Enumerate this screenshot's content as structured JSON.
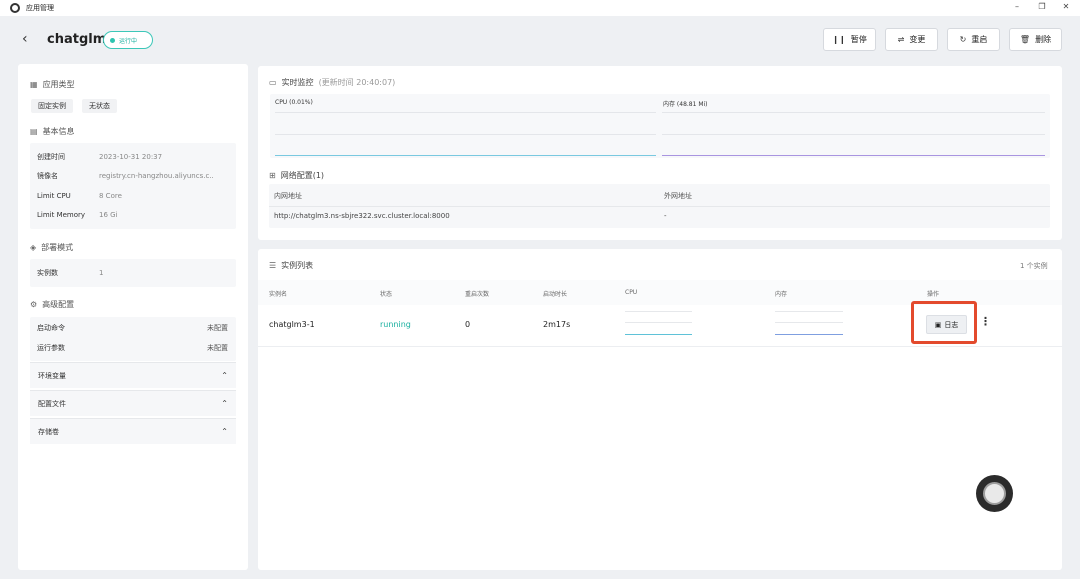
{
  "titlebar": {
    "title": "应用管理",
    "minimize": "–",
    "restore": "❐",
    "close": "✕"
  },
  "header": {
    "back_icon": "chevron-left-icon",
    "app_name": "chatglm3",
    "status": "运行中",
    "status_color": "#2ec4b0",
    "buttons": {
      "pause": "暂停",
      "change": "变更",
      "restart": "重启",
      "delete": "删除"
    }
  },
  "left_panel": {
    "app_type": {
      "title": "应用类型",
      "tags": [
        "固定实例",
        "无状态"
      ]
    },
    "basic_info": {
      "title": "基本信息",
      "rows": [
        {
          "key": "创建时间",
          "value": "2023-10-31 20:37"
        },
        {
          "key": "镜像名",
          "value": "registry.cn-hangzhou.aliyuncs.c.."
        },
        {
          "key": "Limit CPU",
          "value": "8 Core"
        },
        {
          "key": "Limit Memory",
          "value": "16 Gi"
        }
      ]
    },
    "deploy_mode": {
      "title": "部署模式",
      "rows": [
        {
          "key": "实例数",
          "value": "1"
        }
      ]
    },
    "advanced": {
      "title": "高级配置",
      "rows": [
        {
          "key": "启动命令",
          "value": "未配置"
        },
        {
          "key": "运行参数",
          "value": "未配置"
        }
      ],
      "sections": [
        "环境变量",
        "配置文件",
        "存储卷"
      ]
    }
  },
  "monitor": {
    "title": "实时监控",
    "updated": "(更新时间 20:40:07)",
    "cpu_label": "CPU (0.01%)",
    "mem_label": "内存 (48.81 Mi)",
    "cpu_color": "#7ac9e0",
    "mem_color": "#a995e0"
  },
  "network": {
    "title": "网络配置(1)",
    "headers": [
      "内网地址",
      "外网地址"
    ],
    "row": [
      "http://chatglm3.ns-sbjre322.svc.cluster.local:8000",
      "-"
    ]
  },
  "instances": {
    "title": "实例列表",
    "count": "1 个实例",
    "headers": [
      "实例名",
      "状态",
      "重启次数",
      "启动时长",
      "CPU",
      "内存",
      "操作"
    ],
    "rows": [
      {
        "name": "chatglm3-1",
        "status": "running",
        "restarts": "0",
        "uptime": "2m17s",
        "log_button": "日志"
      }
    ],
    "running_color": "#1ab0a0"
  }
}
